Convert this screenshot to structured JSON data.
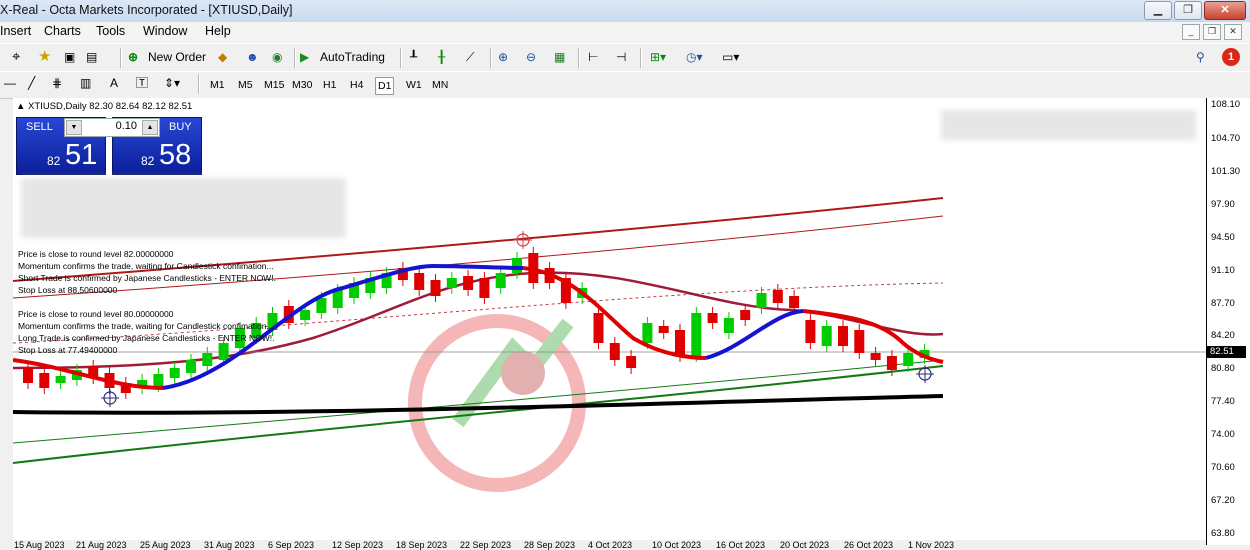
{
  "window": {
    "title": "X-Real - Octa Markets Incorporated - [XTIUSD,Daily]"
  },
  "menu": [
    "Insert",
    "Charts",
    "Tools",
    "Window",
    "Help"
  ],
  "toolbar": {
    "new_order": "New Order",
    "autotrading": "AutoTrading",
    "notification_count": "1"
  },
  "timeframes": [
    "M1",
    "M5",
    "M15",
    "M30",
    "H1",
    "H4",
    "D1",
    "W1",
    "MN"
  ],
  "active_timeframe": "D1",
  "chart": {
    "symbol_line": "XTIUSD,Daily  82.30 82.64 82.12 82.51",
    "current_price": "82.51",
    "price_ticks": [
      "108.10",
      "104.70",
      "101.30",
      "97.90",
      "94.50",
      "91.10",
      "87.70",
      "84.20",
      "80.80",
      "77.40",
      "74.00",
      "70.60",
      "67.20",
      "63.80"
    ],
    "date_ticks": [
      "15 Aug 2023",
      "21 Aug 2023",
      "25 Aug 2023",
      "31 Aug 2023",
      "6 Sep 2023",
      "12 Sep 2023",
      "18 Sep 2023",
      "22 Sep 2023",
      "28 Sep 2023",
      "4 Oct 2023",
      "10 Oct 2023",
      "16 Oct 2023",
      "20 Oct 2023",
      "26 Oct 2023",
      "1 Nov 2023"
    ]
  },
  "trade_panel": {
    "sell_label": "SELL",
    "buy_label": "BUY",
    "lot": "0.10",
    "sell_pre": "82",
    "sell_big": "51",
    "buy_pre": "82",
    "buy_big": "58"
  },
  "comments": [
    "Price is close to round level 82.00000000",
    "Momentum confirms the trade, waiting for Candlestick confimation...",
    "Short Trade is confirmed by Japanese Candlesticks - ENTER NOW!.",
    "Stop Loss at 88.50600000",
    "Price is close to round level 80.00000000",
    "Momentum confirms the trade, waiting for Candlestick confimation...",
    "Long Trade is confirmed by Japanese Candlesticks - ENTER NOW!.",
    "Stop Loss at 77.49400000"
  ],
  "colors": {
    "bull": "#00cc00",
    "bear": "#e00000",
    "ma_up": "#1414d0",
    "ma_down": "#e00000"
  }
}
